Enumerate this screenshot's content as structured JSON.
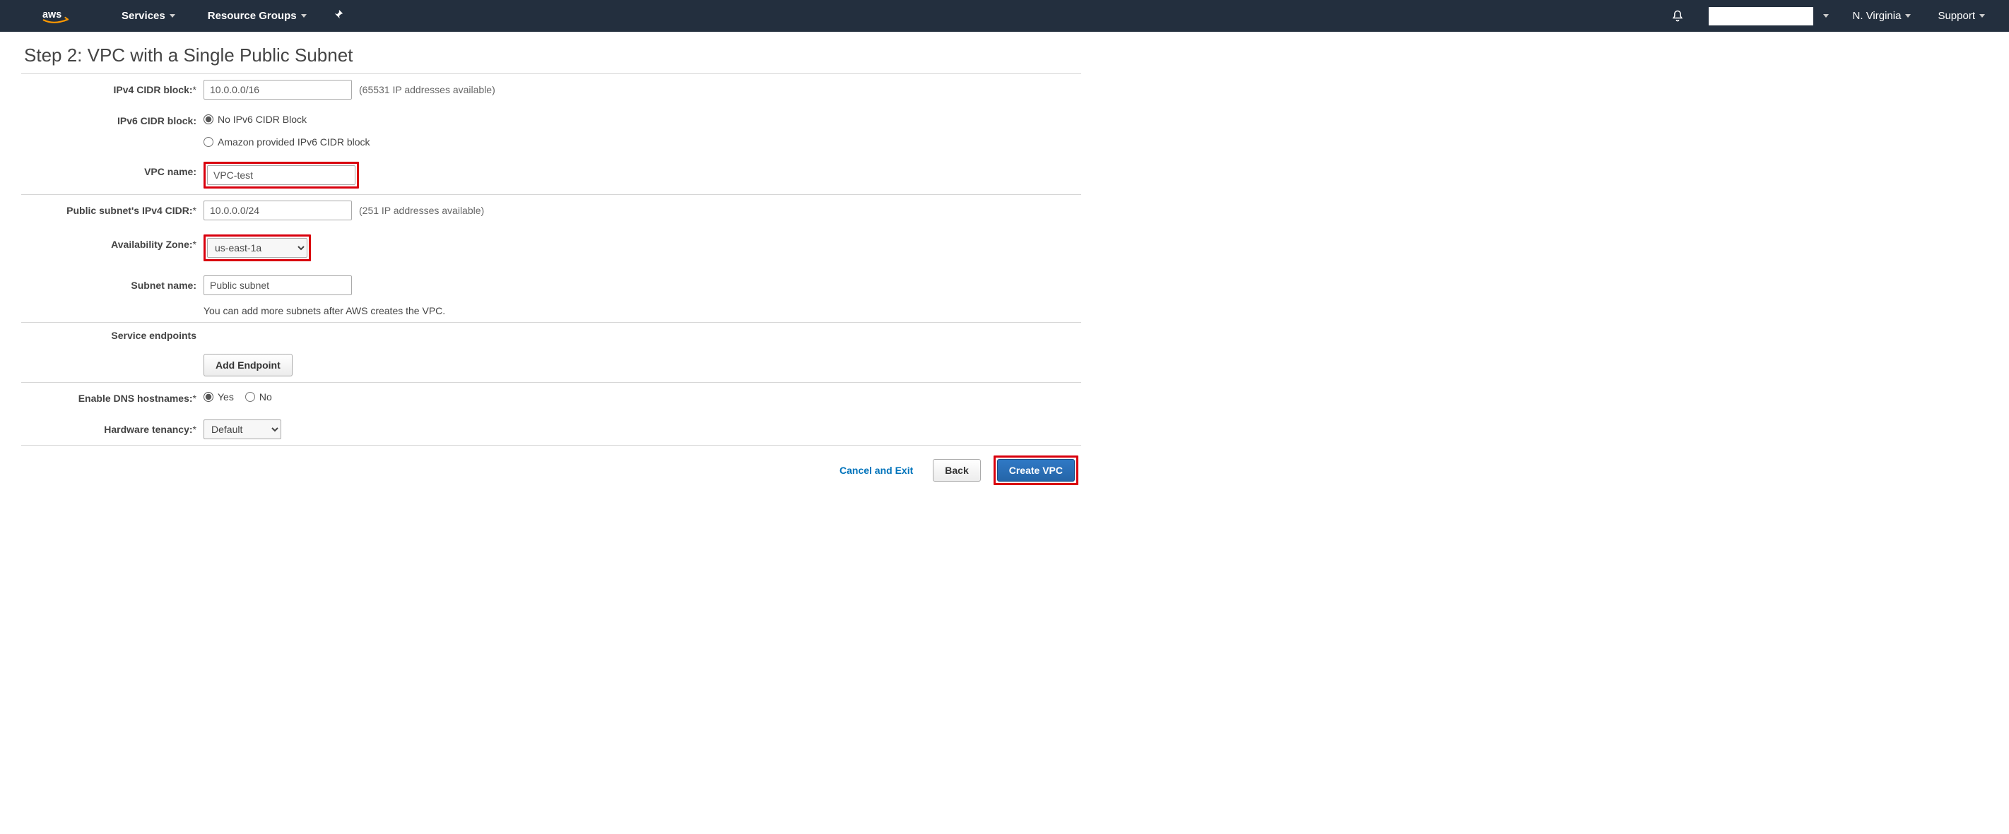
{
  "nav": {
    "services": "Services",
    "resource_groups": "Resource Groups",
    "region": "N. Virginia",
    "support": "Support"
  },
  "page_title": "Step 2: VPC with a Single Public Subnet",
  "labels": {
    "ipv4_cidr": "IPv4 CIDR block:",
    "ipv6_cidr": "IPv6 CIDR block:",
    "vpc_name": "VPC name:",
    "public_subnet_cidr": "Public subnet's IPv4 CIDR:",
    "availability_zone": "Availability Zone:",
    "subnet_name": "Subnet name:",
    "service_endpoints": "Service endpoints",
    "enable_dns_hostnames": "Enable DNS hostnames:",
    "hardware_tenancy": "Hardware tenancy:"
  },
  "fields": {
    "ipv4_cidr_value": "10.0.0.0/16",
    "ipv4_cidr_hint": "(65531 IP addresses available)",
    "ipv6_no": "No IPv6 CIDR Block",
    "ipv6_amazon": "Amazon provided IPv6 CIDR block",
    "vpc_name_value": "VPC-test",
    "public_subnet_cidr_value": "10.0.0.0/24",
    "public_subnet_cidr_hint": "(251 IP addresses available)",
    "availability_zone_value": "us-east-1a",
    "subnet_name_value": "Public subnet",
    "subnet_name_hint": "You can add more subnets after AWS creates the VPC.",
    "add_endpoint_button": "Add Endpoint",
    "dns_yes": "Yes",
    "dns_no": "No",
    "hardware_tenancy_value": "Default"
  },
  "footer": {
    "cancel": "Cancel and Exit",
    "back": "Back",
    "create": "Create VPC"
  }
}
